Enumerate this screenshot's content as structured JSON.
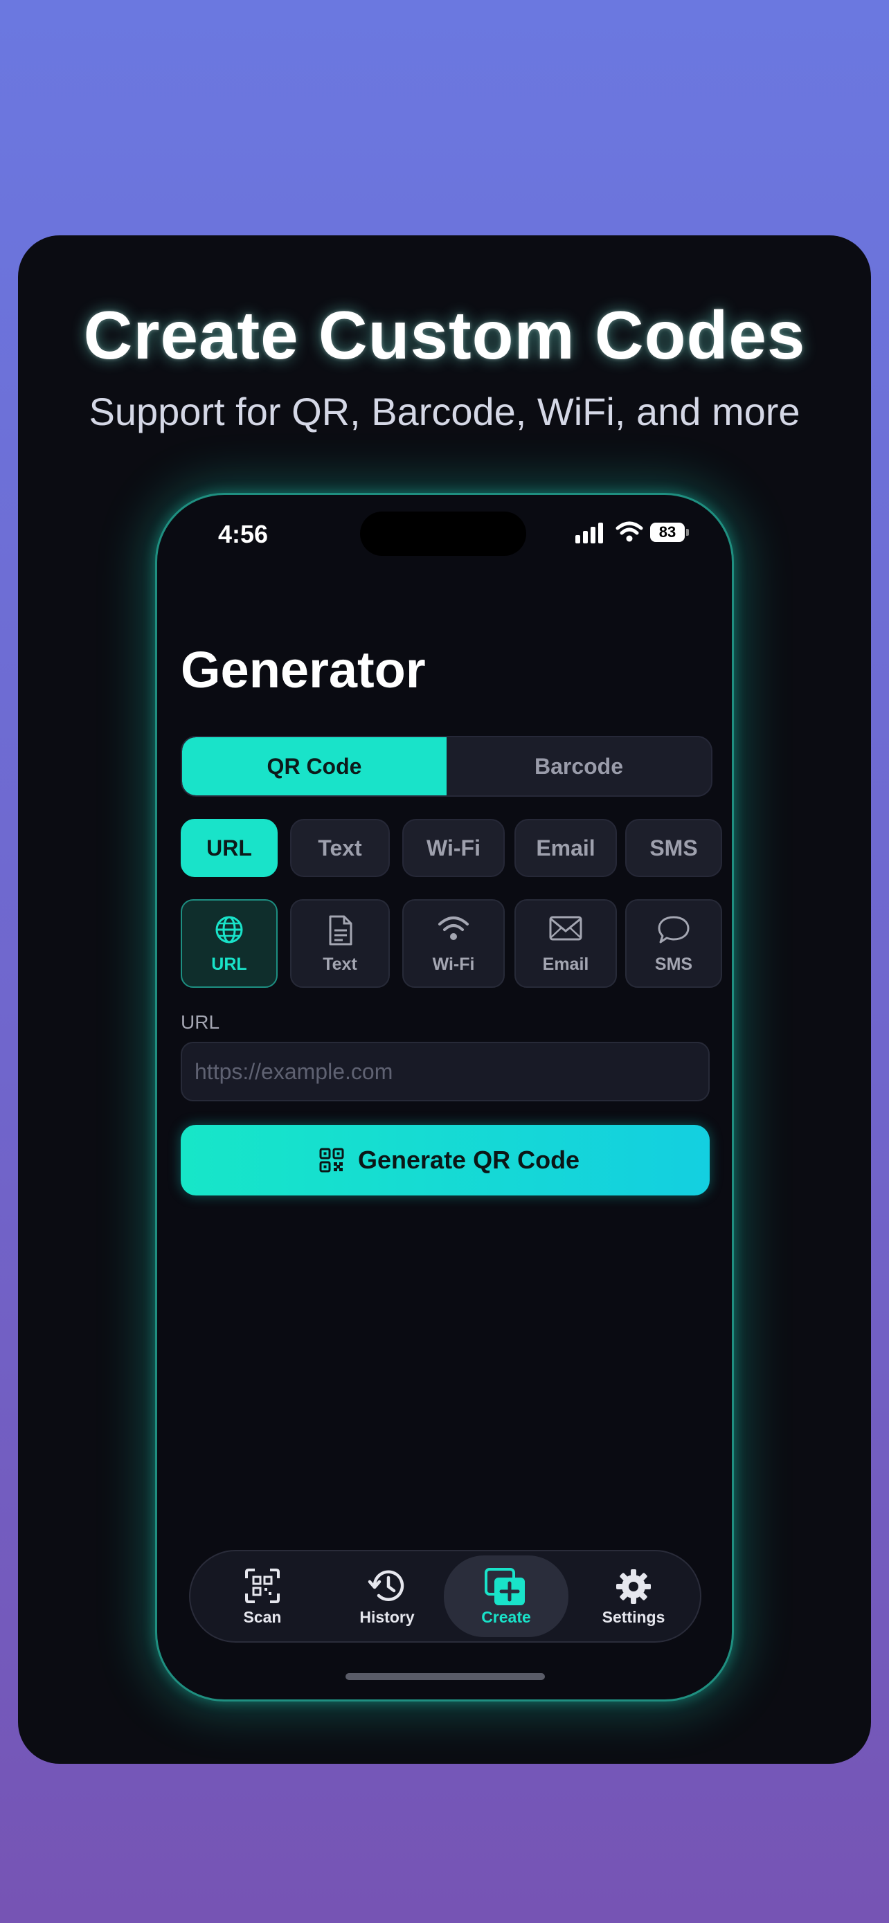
{
  "promo": {
    "headline": "Create Custom Codes",
    "subline": "Support for QR, Barcode, WiFi, and more"
  },
  "status_bar": {
    "time": "4:56",
    "battery": "83"
  },
  "screen": {
    "title": "Generator",
    "segments": [
      {
        "label": "QR Code",
        "selected": true
      },
      {
        "label": "Barcode",
        "selected": false
      }
    ],
    "type_chips": [
      {
        "label": "URL",
        "selected": true
      },
      {
        "label": "Text",
        "selected": false
      },
      {
        "label": "Wi-Fi",
        "selected": false
      },
      {
        "label": "Email",
        "selected": false
      },
      {
        "label": "SMS",
        "selected": false
      }
    ],
    "type_tiles": [
      {
        "label": "URL",
        "icon": "globe-icon",
        "selected": true
      },
      {
        "label": "Text",
        "icon": "document-icon",
        "selected": false
      },
      {
        "label": "Wi-Fi",
        "icon": "wifi-icon",
        "selected": false
      },
      {
        "label": "Email",
        "icon": "envelope-icon",
        "selected": false
      },
      {
        "label": "SMS",
        "icon": "message-bubble-icon",
        "selected": false
      }
    ],
    "field_label": "URL",
    "field_value": "",
    "field_placeholder": "https://example.com",
    "generate_button": {
      "label": "Generate QR Code",
      "icon": "qr-code-icon"
    }
  },
  "tab_bar": {
    "items": [
      {
        "label": "Scan",
        "icon": "scan-qr-icon",
        "selected": false
      },
      {
        "label": "History",
        "icon": "history-clock-icon",
        "selected": false
      },
      {
        "label": "Create",
        "icon": "create-plus-icon",
        "selected": true
      },
      {
        "label": "Settings",
        "icon": "gear-icon",
        "selected": false
      }
    ]
  },
  "colors": {
    "accent": "#19e3c9",
    "background_top": "#6b78e0",
    "background_bottom": "#7654b4",
    "card": "#0b0c12"
  }
}
